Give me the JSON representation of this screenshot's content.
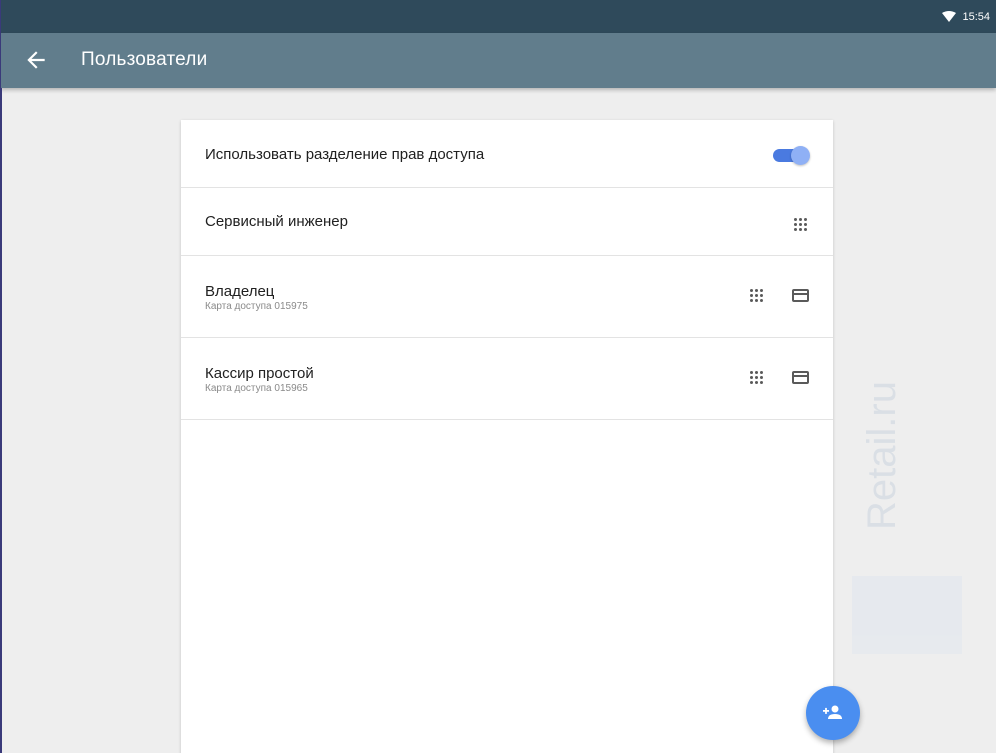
{
  "status_bar": {
    "time": "15:54",
    "wifi_icon": "wifi-icon"
  },
  "app_bar": {
    "back_icon": "arrow-back-icon",
    "title": "Пользователи"
  },
  "settings": {
    "access_separation": {
      "label": "Использовать разделение прав доступа",
      "enabled": true
    },
    "users": [
      {
        "name": "Сервисный инженер",
        "subtitle": "",
        "icons": [
          "dialpad-icon"
        ]
      },
      {
        "name": "Владелец",
        "subtitle": "Карта доступа 015975",
        "icons": [
          "dialpad-icon",
          "credit-card-icon"
        ]
      },
      {
        "name": "Кассир простой",
        "subtitle": "Карта доступа 015965",
        "icons": [
          "dialpad-icon",
          "credit-card-icon"
        ]
      }
    ]
  },
  "watermark": {
    "text": "Retail.ru"
  },
  "fab": {
    "icon": "add-user-icon"
  },
  "colors": {
    "status_bar": "#2f4a5b",
    "app_bar": "#617d8c",
    "accent": "#4a8ef0",
    "toggle_track": "#4a7ae0"
  }
}
